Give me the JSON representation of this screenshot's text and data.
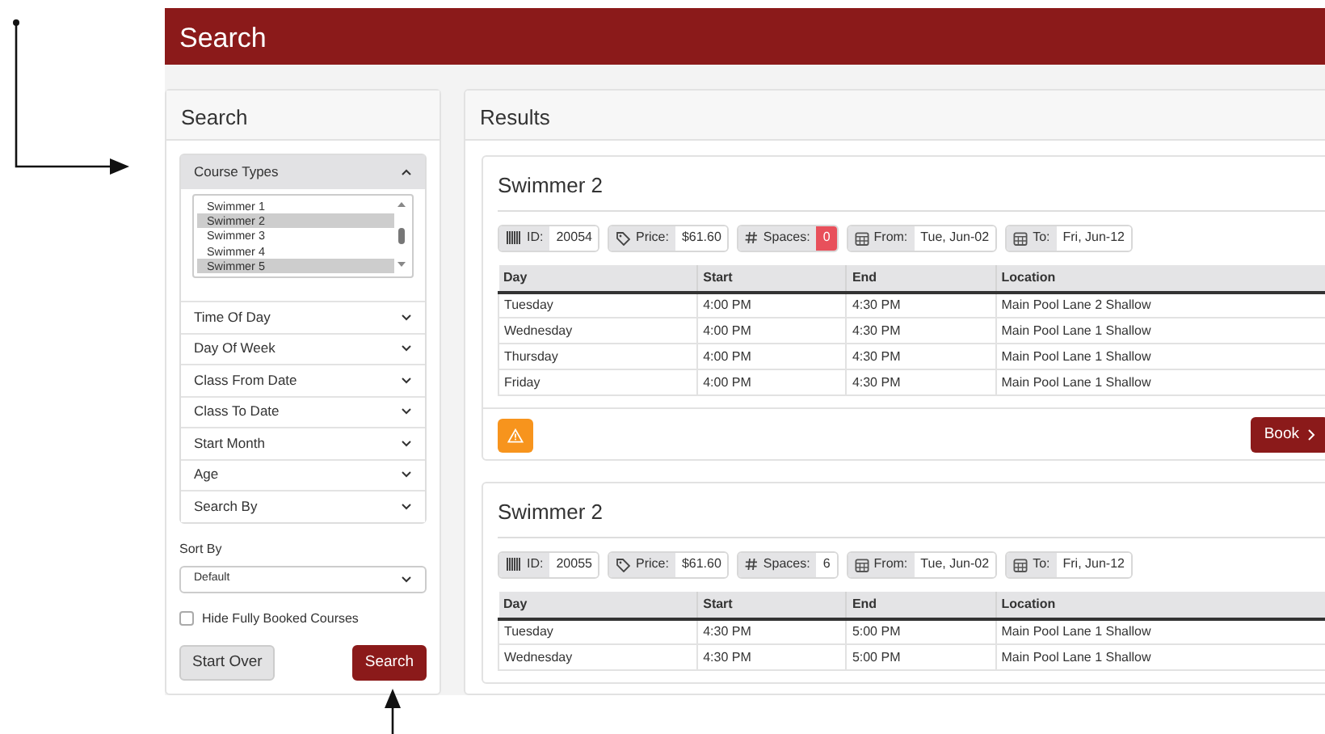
{
  "header": {
    "title": "Search"
  },
  "sidebar": {
    "title": "Search",
    "filters": [
      {
        "label": "Course Types",
        "expanded": true,
        "options": [
          {
            "label": "Swimmer 1",
            "selected": false
          },
          {
            "label": "Swimmer 2",
            "selected": true
          },
          {
            "label": "Swimmer 3",
            "selected": false
          },
          {
            "label": "Swimmer 4",
            "selected": false
          },
          {
            "label": "Swimmer 5",
            "selected": true
          }
        ]
      },
      {
        "label": "Time Of Day",
        "expanded": false
      },
      {
        "label": "Day Of Week",
        "expanded": false
      },
      {
        "label": "Class From Date",
        "expanded": false
      },
      {
        "label": "Class To Date",
        "expanded": false
      },
      {
        "label": "Start Month",
        "expanded": false
      },
      {
        "label": "Age",
        "expanded": false
      },
      {
        "label": "Search By",
        "expanded": false
      }
    ],
    "sort": {
      "label": "Sort By",
      "value": "Default"
    },
    "hide_full": {
      "label": "Hide Fully Booked Courses",
      "checked": false
    },
    "buttons": [
      {
        "label": "Start Over",
        "kind": "secondary"
      },
      {
        "label": "Search",
        "kind": "primary"
      }
    ]
  },
  "results": {
    "title": "Results",
    "courses": [
      {
        "title": "Swimmer 2",
        "fields": [
          {
            "kind": "id",
            "label": "ID:",
            "value": "20054"
          },
          {
            "kind": "price",
            "label": "Price:",
            "value": "$61.60"
          },
          {
            "kind": "spaces",
            "label": "Spaces:",
            "value": "0",
            "full": true
          },
          {
            "kind": "date",
            "label": "From:",
            "value": "Tue, Jun-02"
          },
          {
            "kind": "date",
            "label": "To:",
            "value": "Fri, Jun-12"
          }
        ],
        "columns": [
          "Day",
          "Start",
          "End",
          "Location"
        ],
        "rows": [
          [
            "Tuesday",
            "4:00 PM",
            "4:30 PM",
            "Main Pool Lane 2 Shallow"
          ],
          [
            "Wednesday",
            "4:00 PM",
            "4:30 PM",
            "Main Pool Lane 1 Shallow"
          ],
          [
            "Thursday",
            "4:00 PM",
            "4:30 PM",
            "Main Pool Lane 1 Shallow"
          ],
          [
            "Friday",
            "4:00 PM",
            "4:30 PM",
            "Main Pool Lane 1 Shallow"
          ]
        ],
        "footer": {
          "warning": true,
          "book": "Book"
        }
      },
      {
        "title": "Swimmer 2",
        "fields": [
          {
            "kind": "id",
            "label": "ID:",
            "value": "20055"
          },
          {
            "kind": "price",
            "label": "Price:",
            "value": "$61.60"
          },
          {
            "kind": "spaces",
            "label": "Spaces:",
            "value": "6",
            "full": false
          },
          {
            "kind": "date",
            "label": "From:",
            "value": "Tue, Jun-02"
          },
          {
            "kind": "date",
            "label": "To:",
            "value": "Fri, Jun-12"
          }
        ],
        "columns": [
          "Day",
          "Start",
          "End",
          "Location"
        ],
        "rows": [
          [
            "Tuesday",
            "4:30 PM",
            "5:00 PM",
            "Main Pool Lane 1 Shallow"
          ],
          [
            "Wednesday",
            "4:30 PM",
            "5:00 PM",
            "Main Pool Lane 1 Shallow"
          ]
        ]
      }
    ]
  }
}
